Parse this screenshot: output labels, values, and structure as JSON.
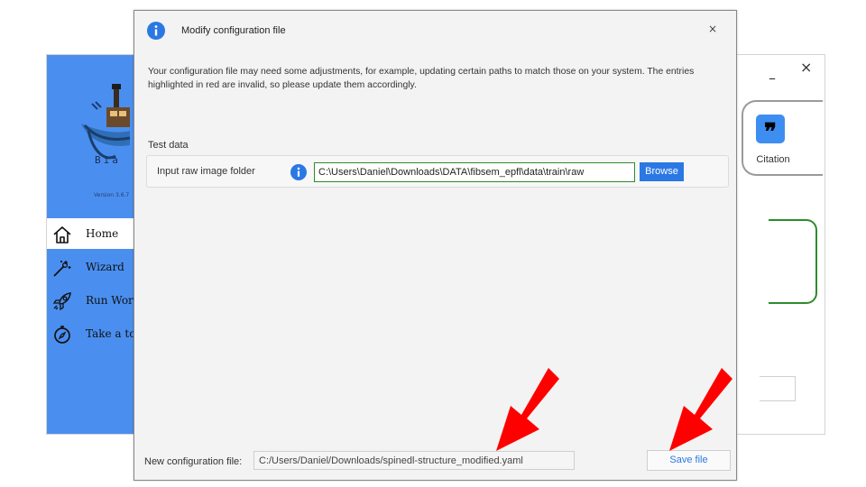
{
  "main_window": {
    "minimize_glyph": "–",
    "close_glyph": "×",
    "brand_text": "Bia",
    "version": "Version 3.6.7",
    "nav": [
      {
        "label": "Home",
        "icon": "home-icon",
        "active": true
      },
      {
        "label": "Wizard",
        "icon": "magic-wand-icon",
        "active": false
      },
      {
        "label": "Run Wor",
        "icon": "rocket-icon",
        "active": false
      },
      {
        "label": "Take a to",
        "icon": "compass-icon",
        "active": false
      }
    ],
    "citation_label": "Citation",
    "citation_icon": "quote-icon"
  },
  "dialog": {
    "title": "Modify configuration file",
    "close_glyph": "×",
    "description": "Your configuration file may need some adjustments, for example, updating certain paths to match those on your system. The entries highlighted in red are invalid, so please update them accordingly.",
    "section": "Test data",
    "field": {
      "label": "Input raw image folder",
      "value": "C:\\Users\\Daniel\\Downloads\\DATA\\fibsem_epfl\\data\\train\\raw",
      "browse_label": "Browse"
    },
    "footer": {
      "label": "New configuration file:",
      "value": "C:/Users/Daniel/Downloads/spinedl-structure_modified.yaml",
      "save_label": "Save file"
    }
  },
  "colors": {
    "sidebar": "#4a8ff0",
    "accent": "#2b78e4",
    "valid_border": "#2e8b2e",
    "arrow": "#ff0000"
  }
}
